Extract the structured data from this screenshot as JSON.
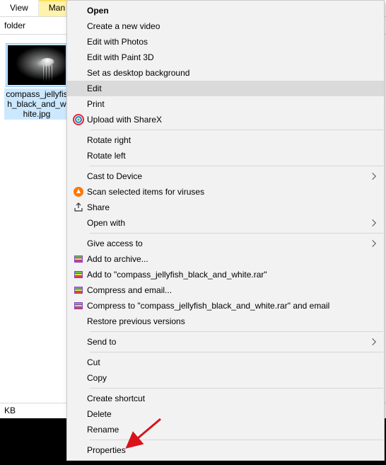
{
  "ribbon": {
    "tab_view": "View",
    "tab_manage": "Man"
  },
  "subbar": {
    "text": "folder"
  },
  "file": {
    "label": "compass_jellyfish_black_and_white.jpg"
  },
  "status": {
    "size": "KB"
  },
  "context_menu": {
    "open": "Open",
    "create_video": "Create a new video",
    "edit_photos": "Edit with Photos",
    "edit_paint3d": "Edit with Paint 3D",
    "set_background": "Set as desktop background",
    "edit": "Edit",
    "print": "Print",
    "upload_sharex": "Upload with ShareX",
    "rotate_right": "Rotate right",
    "rotate_left": "Rotate left",
    "cast": "Cast to Device",
    "scan": "Scan selected items for viruses",
    "share": "Share",
    "open_with": "Open with",
    "give_access": "Give access to",
    "add_archive": "Add to archive...",
    "add_to_rar": "Add to \"compass_jellyfish_black_and_white.rar\"",
    "compress_email": "Compress and email...",
    "compress_to_email": "Compress to \"compass_jellyfish_black_and_white.rar\" and email",
    "restore": "Restore previous versions",
    "send_to": "Send to",
    "cut": "Cut",
    "copy": "Copy",
    "create_shortcut": "Create shortcut",
    "delete": "Delete",
    "rename": "Rename",
    "properties": "Properties"
  }
}
